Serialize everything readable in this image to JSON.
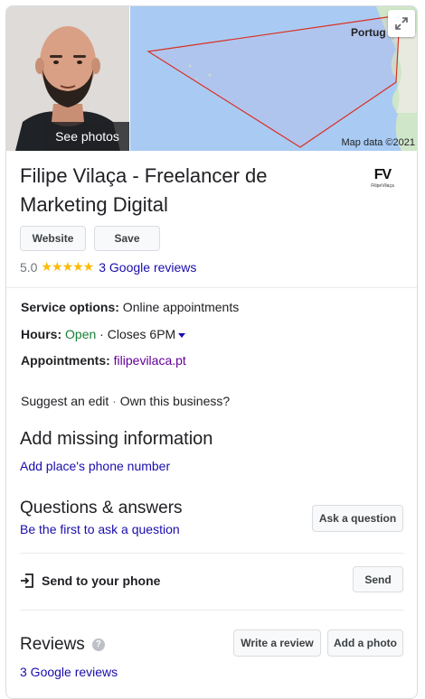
{
  "hero": {
    "see_photos": "See photos",
    "map_label": "Portug",
    "map_data": "Map data ©2021"
  },
  "business": {
    "name": "Filipe Vilaça - Freelancer de Marketing Digital",
    "logo_mark": "FV",
    "logo_text": "FilipeVilaça"
  },
  "actions": {
    "website": "Website",
    "save": "Save"
  },
  "rating": {
    "score": "5.0",
    "stars": "★★★★★",
    "stars_value": 5,
    "reviews_link": "3 Google reviews"
  },
  "info": {
    "service_label": "Service options:",
    "service_value": " Online appointments",
    "hours_label": "Hours:",
    "hours_status": "Open",
    "hours_sep": " · ",
    "hours_close": "Closes 6PM",
    "appointments_label": "Appointments:",
    "appointments_value": "filipevilaca.pt"
  },
  "edit": {
    "suggest": "Suggest an edit",
    "sep": " · ",
    "own": "Own this business?"
  },
  "missing": {
    "title": "Add missing information",
    "phone_link": "Add place's phone number"
  },
  "qa": {
    "title": "Questions & answers",
    "first_link": "Be the first to ask a question",
    "ask_button": "Ask a question"
  },
  "send": {
    "label": "Send to your phone",
    "button": "Send"
  },
  "reviews": {
    "title": "Reviews",
    "help": "?",
    "write_button": "Write a review",
    "photo_button": "Add a photo",
    "link": "3 Google reviews"
  },
  "colors": {
    "link": "#1a0dab",
    "open": "#188038",
    "star": "#fbbc04",
    "map_water": "#a9cbf3",
    "polygon": "#d93025"
  }
}
